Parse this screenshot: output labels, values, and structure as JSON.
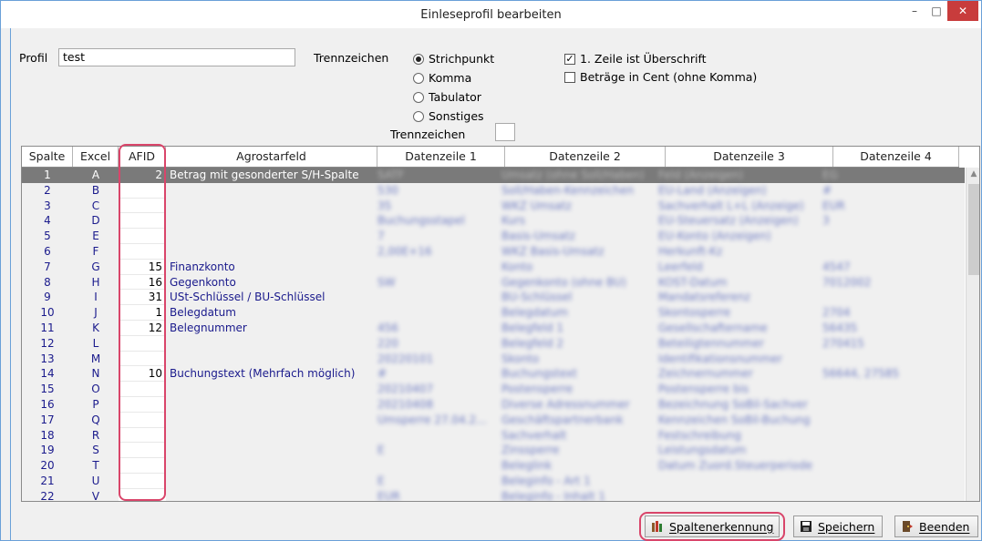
{
  "window": {
    "title": "Einleseprofil bearbeiten",
    "min": "–",
    "max": "□",
    "close": "✕"
  },
  "profil": {
    "label": "Profil",
    "value": "test"
  },
  "trenn": {
    "label": "Trennzeichen",
    "options": [
      "Strichpunkt",
      "Komma",
      "Tabulator",
      "Sonstiges"
    ],
    "selected": "Strichpunkt",
    "custom_label": "Trennzeichen",
    "custom_value": ""
  },
  "options": {
    "first_row_header": {
      "label": "1. Zeile ist Überschrift",
      "checked": true
    },
    "cents": {
      "label": "Beträge in Cent (ohne Komma)",
      "checked": false
    }
  },
  "table": {
    "headers": [
      "Spalte",
      "Excel",
      "AFID",
      "Agrostarfeld",
      "Datenzeile 1",
      "Datenzeile 2",
      "Datenzeile 3",
      "Datenzeile 4"
    ],
    "rows": [
      {
        "spalte": "1",
        "excel": "A",
        "afid": "2",
        "feld": "Betrag mit gesonderter S/H-Spalte",
        "d1": "SATF",
        "d2": "Umsatz (ohne Soll/Haben)",
        "d3": "Feld (Anzeigen)",
        "d4": "EG",
        "selected": true
      },
      {
        "spalte": "2",
        "excel": "B",
        "afid": "",
        "feld": "",
        "d1": "530",
        "d2": "Soll/Haben-Kennzeichen",
        "d3": "EU-Land (Anzeigen)",
        "d4": "#"
      },
      {
        "spalte": "3",
        "excel": "C",
        "afid": "",
        "feld": "",
        "d1": "35",
        "d2": "WKZ Umsatz",
        "d3": "Sachverhalt L+L (Anzeige)",
        "d4": "EUR"
      },
      {
        "spalte": "4",
        "excel": "D",
        "afid": "",
        "feld": "",
        "d1": "Buchungsstapel",
        "d2": "Kurs",
        "d3": "EU-Steuersatz (Anzeigen)",
        "d4": "3"
      },
      {
        "spalte": "5",
        "excel": "E",
        "afid": "",
        "feld": "",
        "d1": "7",
        "d2": "Basis-Umsatz",
        "d3": "EU-Konto (Anzeigen)",
        "d4": ""
      },
      {
        "spalte": "6",
        "excel": "F",
        "afid": "",
        "feld": "",
        "d1": "2,00E+16",
        "d2": "WKZ Basis-Umsatz",
        "d3": "Herkunft-Kz",
        "d4": ""
      },
      {
        "spalte": "7",
        "excel": "G",
        "afid": "15",
        "feld": "Finanzkonto",
        "d1": "",
        "d2": "Konto",
        "d3": "Leerfeld",
        "d4": "4547"
      },
      {
        "spalte": "8",
        "excel": "H",
        "afid": "16",
        "feld": "Gegenkonto",
        "d1": "SW",
        "d2": "Gegenkonto (ohne BU)",
        "d3": "KOST-Datum",
        "d4": "7012002"
      },
      {
        "spalte": "9",
        "excel": "I",
        "afid": "31",
        "feld": "USt-Schlüssel / BU-Schlüssel",
        "d1": "",
        "d2": "BU-Schlüssel",
        "d3": "Mandatsreferenz",
        "d4": ""
      },
      {
        "spalte": "10",
        "excel": "J",
        "afid": "1",
        "feld": "Belegdatum",
        "d1": "",
        "d2": "Belegdatum",
        "d3": "Skontosperre",
        "d4": "2704"
      },
      {
        "spalte": "11",
        "excel": "K",
        "afid": "12",
        "feld": "Belegnummer",
        "d1": "456",
        "d2": "Belegfeld 1",
        "d3": "Gesellschaftername",
        "d4": "56435"
      },
      {
        "spalte": "12",
        "excel": "L",
        "afid": "",
        "feld": "",
        "d1": "220",
        "d2": "Belegfeld 2",
        "d3": "Beteiligtennummer",
        "d4": "270415"
      },
      {
        "spalte": "13",
        "excel": "M",
        "afid": "",
        "feld": "",
        "d1": "20220101",
        "d2": "Skonto",
        "d3": "Identifikationsnummer",
        "d4": ""
      },
      {
        "spalte": "14",
        "excel": "N",
        "afid": "10",
        "feld": "Buchungstext (Mehrfach möglich)",
        "d1": "#",
        "d2": "Buchungstext",
        "d3": "Zeichnernummer",
        "d4": "56644, 27585"
      },
      {
        "spalte": "15",
        "excel": "O",
        "afid": "",
        "feld": "",
        "d1": "20210407",
        "d2": "Postensperre",
        "d3": "Postensperre bis",
        "d4": ""
      },
      {
        "spalte": "16",
        "excel": "P",
        "afid": "",
        "feld": "",
        "d1": "20210408",
        "d2": "Diverse Adressnummer",
        "d3": "Bezeichnung SoBil-Sachver",
        "d4": ""
      },
      {
        "spalte": "17",
        "excel": "Q",
        "afid": "",
        "feld": "",
        "d1": "Umsperre 27.04.2...",
        "d2": "Geschäftspartnerbank",
        "d3": "Kennzeichen SoBil-Buchung",
        "d4": ""
      },
      {
        "spalte": "18",
        "excel": "R",
        "afid": "",
        "feld": "",
        "d1": "",
        "d2": "Sachverhalt",
        "d3": "Festschreibung",
        "d4": ""
      },
      {
        "spalte": "19",
        "excel": "S",
        "afid": "",
        "feld": "",
        "d1": "E",
        "d2": "Zinssperre",
        "d3": "Leistungsdatum",
        "d4": ""
      },
      {
        "spalte": "20",
        "excel": "T",
        "afid": "",
        "feld": "",
        "d1": "",
        "d2": "Beleglink",
        "d3": "Datum Zuord.Steuerperiode",
        "d4": ""
      },
      {
        "spalte": "21",
        "excel": "U",
        "afid": "",
        "feld": "",
        "d1": "E",
        "d2": "Beleginfo - Art 1",
        "d3": "",
        "d4": ""
      },
      {
        "spalte": "22",
        "excel": "V",
        "afid": "",
        "feld": "",
        "d1": "EUR",
        "d2": "Beleginfo - Inhalt 1",
        "d3": "",
        "d4": ""
      }
    ]
  },
  "buttons": {
    "spaltenerkennung": "Spaltenerkennung",
    "speichern": "Speichern",
    "beenden": "Beenden"
  },
  "colors": {
    "highlight": "#d9456a",
    "selected_row": "#7a7a7a",
    "field_text": "#1a1a8c"
  }
}
